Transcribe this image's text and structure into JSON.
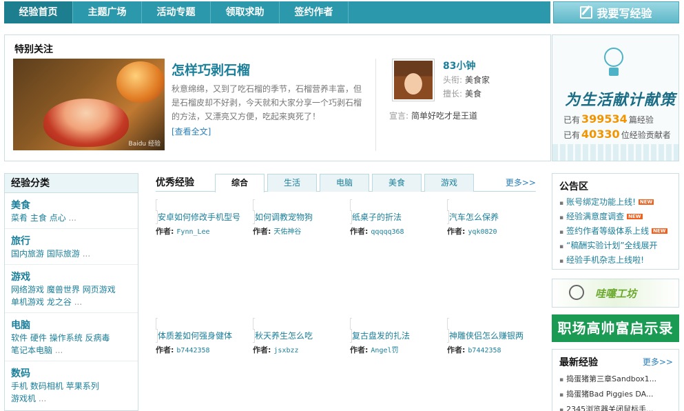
{
  "nav": {
    "items": [
      "经验首页",
      "主题广场",
      "活动专题",
      "领取求助",
      "签约作者"
    ],
    "write_label": "我要写经验"
  },
  "special": {
    "title": "特别关注",
    "feature": {
      "title": "怎样巧剥石榴",
      "desc": "秋意绵绵，又到了吃石榴的季节，石榴营养丰富，但是石榴皮却不好剥，今天就和大家分享一个巧剥石榴的方法，又漂亮又方便，吃起来爽死了！",
      "more": "[查看全文]",
      "img_mark": "Baidu 经验"
    },
    "author": {
      "name": "83小钟",
      "title_label": "头衔:",
      "title_value": "美食家",
      "skill_label": "擅长:",
      "skill_value": "美食",
      "motto_label": "宣言:",
      "motto_value": "简单好吃才是王道"
    }
  },
  "promo": {
    "slogan": "为生活献计献策",
    "stat1_prefix": "已有",
    "stat1_num": "399534",
    "stat1_suffix": "篇经验",
    "stat2_prefix": "已有",
    "stat2_num": "40330",
    "stat2_suffix": "位经验贡献者"
  },
  "categories": {
    "title": "经验分类",
    "items": [
      {
        "name": "美食",
        "subs": [
          "菜肴",
          "主食",
          "点心",
          "..."
        ]
      },
      {
        "name": "旅行",
        "subs": [
          "国内旅游",
          "国际旅游",
          "..."
        ]
      },
      {
        "name": "游戏",
        "subs": [
          "网络游戏",
          "魔兽世界",
          "网页游戏",
          "单机游戏",
          "龙之谷",
          "..."
        ]
      },
      {
        "name": "电脑",
        "subs": [
          "软件",
          "硬件",
          "操作系统",
          "反病毒",
          "笔记本电脑",
          "..."
        ]
      },
      {
        "name": "数码",
        "subs": [
          "手机",
          "数码相机",
          "苹果系列",
          "游戏机",
          "..."
        ]
      }
    ]
  },
  "excellent": {
    "title": "优秀经验",
    "tabs": [
      "综合",
      "生活",
      "电脑",
      "美食",
      "游戏"
    ],
    "more": "更多>>",
    "author_label": "作者:",
    "cards": [
      {
        "title": "安卓如何修改手机型号",
        "author": "Fynn_Lee"
      },
      {
        "title": "如何调教宠物狗",
        "author": "天佑神谷"
      },
      {
        "title": "纸桌子的折法",
        "author": "qqqqq368"
      },
      {
        "title": "汽车怎么保养",
        "author": "yqk0820"
      },
      {
        "title": "体质差如何强身健体",
        "author": "b7442358"
      },
      {
        "title": "秋天养生怎么吃",
        "author": "jsxbzz"
      },
      {
        "title": "复古盘发的扎法",
        "author": "Angel罚"
      },
      {
        "title": "神雕侠侣怎么赚银两",
        "author": "b7442358"
      }
    ]
  },
  "notice": {
    "title": "公告区",
    "items": [
      {
        "text": "账号绑定功能上线!",
        "new": "NEW"
      },
      {
        "text": "经验满意度调查",
        "new": "NEW"
      },
      {
        "text": "签约作者等级体系上线",
        "new": "NEW"
      },
      {
        "text": "“稿酬实验计划”全线展开",
        "new": ""
      },
      {
        "text": "经验手机杂志上线啦!",
        "new": ""
      }
    ]
  },
  "banners": {
    "b1": "哇噻工坊",
    "b2": "职场高帅富启示录"
  },
  "latest": {
    "title": "最新经验",
    "more": "更多>>",
    "items": [
      "捣蛋猪第三章Sandbox1...",
      "捣蛋猪Bad Piggies DA...",
      "2345浏览器关闭鼠标手..."
    ]
  }
}
